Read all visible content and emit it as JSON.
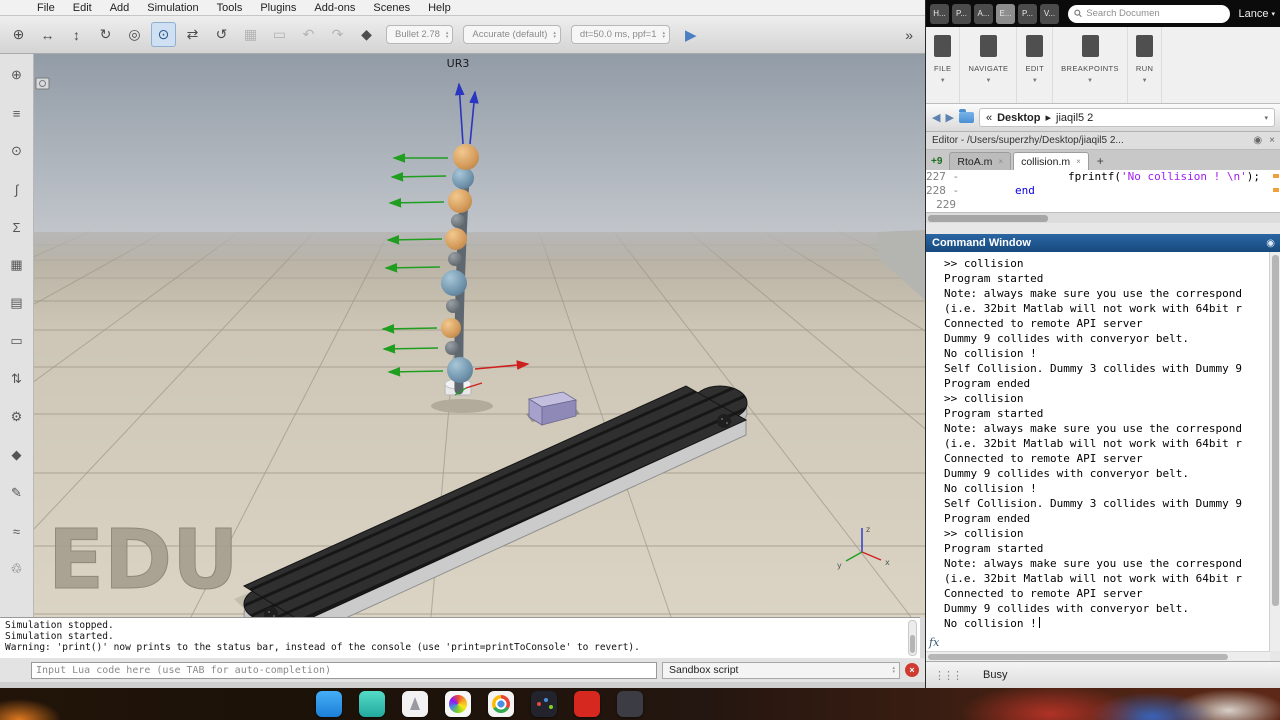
{
  "sim": {
    "menu_items": [
      "File",
      "Edit",
      "Add",
      "Simulation",
      "Tools",
      "Plugins",
      "Add-ons",
      "Scenes",
      "Help"
    ],
    "toolbar": {
      "icons": [
        {
          "name": "camera-translate-icon",
          "disabled": false,
          "active": false
        },
        {
          "name": "camera-pan-icon",
          "disabled": false,
          "active": false
        },
        {
          "name": "camera-lift-icon",
          "disabled": false,
          "active": false
        },
        {
          "name": "camera-rotate-icon",
          "disabled": false,
          "active": false
        },
        {
          "name": "camera-angle-icon",
          "disabled": false,
          "active": false
        },
        {
          "name": "zoom-icon",
          "disabled": false,
          "active": true
        },
        {
          "name": "object-translate-icon",
          "disabled": false,
          "active": false
        },
        {
          "name": "object-rotate-icon",
          "disabled": false,
          "active": false
        },
        {
          "name": "assemble-icon",
          "disabled": true,
          "active": false
        },
        {
          "name": "transfer-icon",
          "disabled": true,
          "active": false
        },
        {
          "name": "undo-icon",
          "disabled": true,
          "active": false
        },
        {
          "name": "redo-icon",
          "disabled": true,
          "active": false
        },
        {
          "name": "measurement-icon",
          "disabled": false,
          "active": false
        }
      ],
      "engine_select": "Bullet 2.78",
      "accuracy_select": "Accurate (default)",
      "dt_select": "dt=50.0 ms, ppf=1",
      "overflow": "»"
    },
    "left_toolbar_icons": [
      "camera-move-icon",
      "scene-hierarchy-icon",
      "zoom-fit-icon",
      "script-editor-icon",
      "calc-modules-icon",
      "model-browser-icon",
      "layers-icon",
      "selection-icon",
      "shift-icon",
      "joint-tool-icon",
      "collections-icon",
      "graphs-icon",
      "paths-icon",
      "environment-icon"
    ],
    "viewport": {
      "object_label": "UR3",
      "watermark": "EDU",
      "axis_labels": [
        "x",
        "y",
        "z"
      ]
    },
    "status_lines": [
      "Simulation stopped.",
      "Simulation started.",
      "Warning: 'print()' now prints to the status bar, instead of the console (use 'print=printToConsole' to revert)."
    ],
    "lua_input_placeholder": "Input Lua code here (use TAB for auto-completion)",
    "script_select": "Sandbox script"
  },
  "matlab": {
    "menubar": {
      "tabs": [
        {
          "label": "H...",
          "active": false
        },
        {
          "label": "P...",
          "active": false
        },
        {
          "label": "A...",
          "active": false
        },
        {
          "label": "E...",
          "active": true
        },
        {
          "label": "P...",
          "active": false
        },
        {
          "label": "V...",
          "active": false
        }
      ],
      "search_placeholder": "Search Documen",
      "user_menu": "Lance"
    },
    "ribbon_sections": [
      "FILE",
      "NAVIGATE",
      "EDIT",
      "BREAKPOINTS",
      "RUN"
    ],
    "pathbar": {
      "collapse": "«",
      "parent": "Desktop",
      "separator": "▸",
      "current": "jiaqil5 2"
    },
    "editor": {
      "title": "Editor - /Users/superzhy/Desktop/jiaqil5 2...",
      "overflow_badge": "+9",
      "tabs": [
        {
          "label": "RtoA.m",
          "active": false
        },
        {
          "label": "collision.m",
          "active": true
        }
      ],
      "new_tab": "+",
      "code_lines": [
        {
          "num": "227 -",
          "segments": [
            {
              "c": "plain",
              "t": "                fprintf("
            },
            {
              "c": "string",
              "t": "'No collision ! \\n'"
            },
            {
              "c": "plain",
              "t": ");"
            }
          ]
        },
        {
          "num": "228 -",
          "segments": [
            {
              "c": "keyword",
              "t": "        end"
            }
          ]
        },
        {
          "num": "229",
          "segments": []
        }
      ]
    },
    "command_window": {
      "title": "Command Window",
      "lines": [
        ">> collision",
        "Program started",
        "Note: always make sure you use the correspond",
        "(i.e. 32bit Matlab will not work with 64bit r",
        "Connected to remote API server",
        "Dummy 9 collides with converyor belt.",
        "No collision !",
        "Self Collision. Dummy 3 collides with Dummy 9",
        "Program ended",
        ">> collision",
        "Program started",
        "Note: always make sure you use the correspond",
        "(i.e. 32bit Matlab will not work with 64bit r",
        "Connected to remote API server",
        "Dummy 9 collides with converyor belt.",
        "No collision !",
        "Self Collision. Dummy 3 collides with Dummy 9",
        "Program ended",
        ">> collision",
        "Program started",
        "Note: always make sure you use the correspond",
        "(i.e. 32bit Matlab will not work with 64bit r",
        "Connected to remote API server",
        "Dummy 9 collides with converyor belt.",
        "No collision !"
      ],
      "fx": "fx"
    },
    "status": "Busy"
  },
  "dock": {
    "icons": [
      "finder",
      "messages",
      "launchpad",
      "photos",
      "chrome",
      "coppeliasim",
      "adobe",
      "extra-app"
    ]
  },
  "colors": {
    "cmd_header_blue": "#1d5288",
    "matlab_string": "#a020f0",
    "matlab_keyword": "#0d00e6",
    "close_button_red": "#cf3b30",
    "play_button_blue": "#4a7fc1",
    "robot_tan": "#d39a5a",
    "robot_blue": "#6f93ab",
    "floor_beige": "#d2cbbb"
  }
}
